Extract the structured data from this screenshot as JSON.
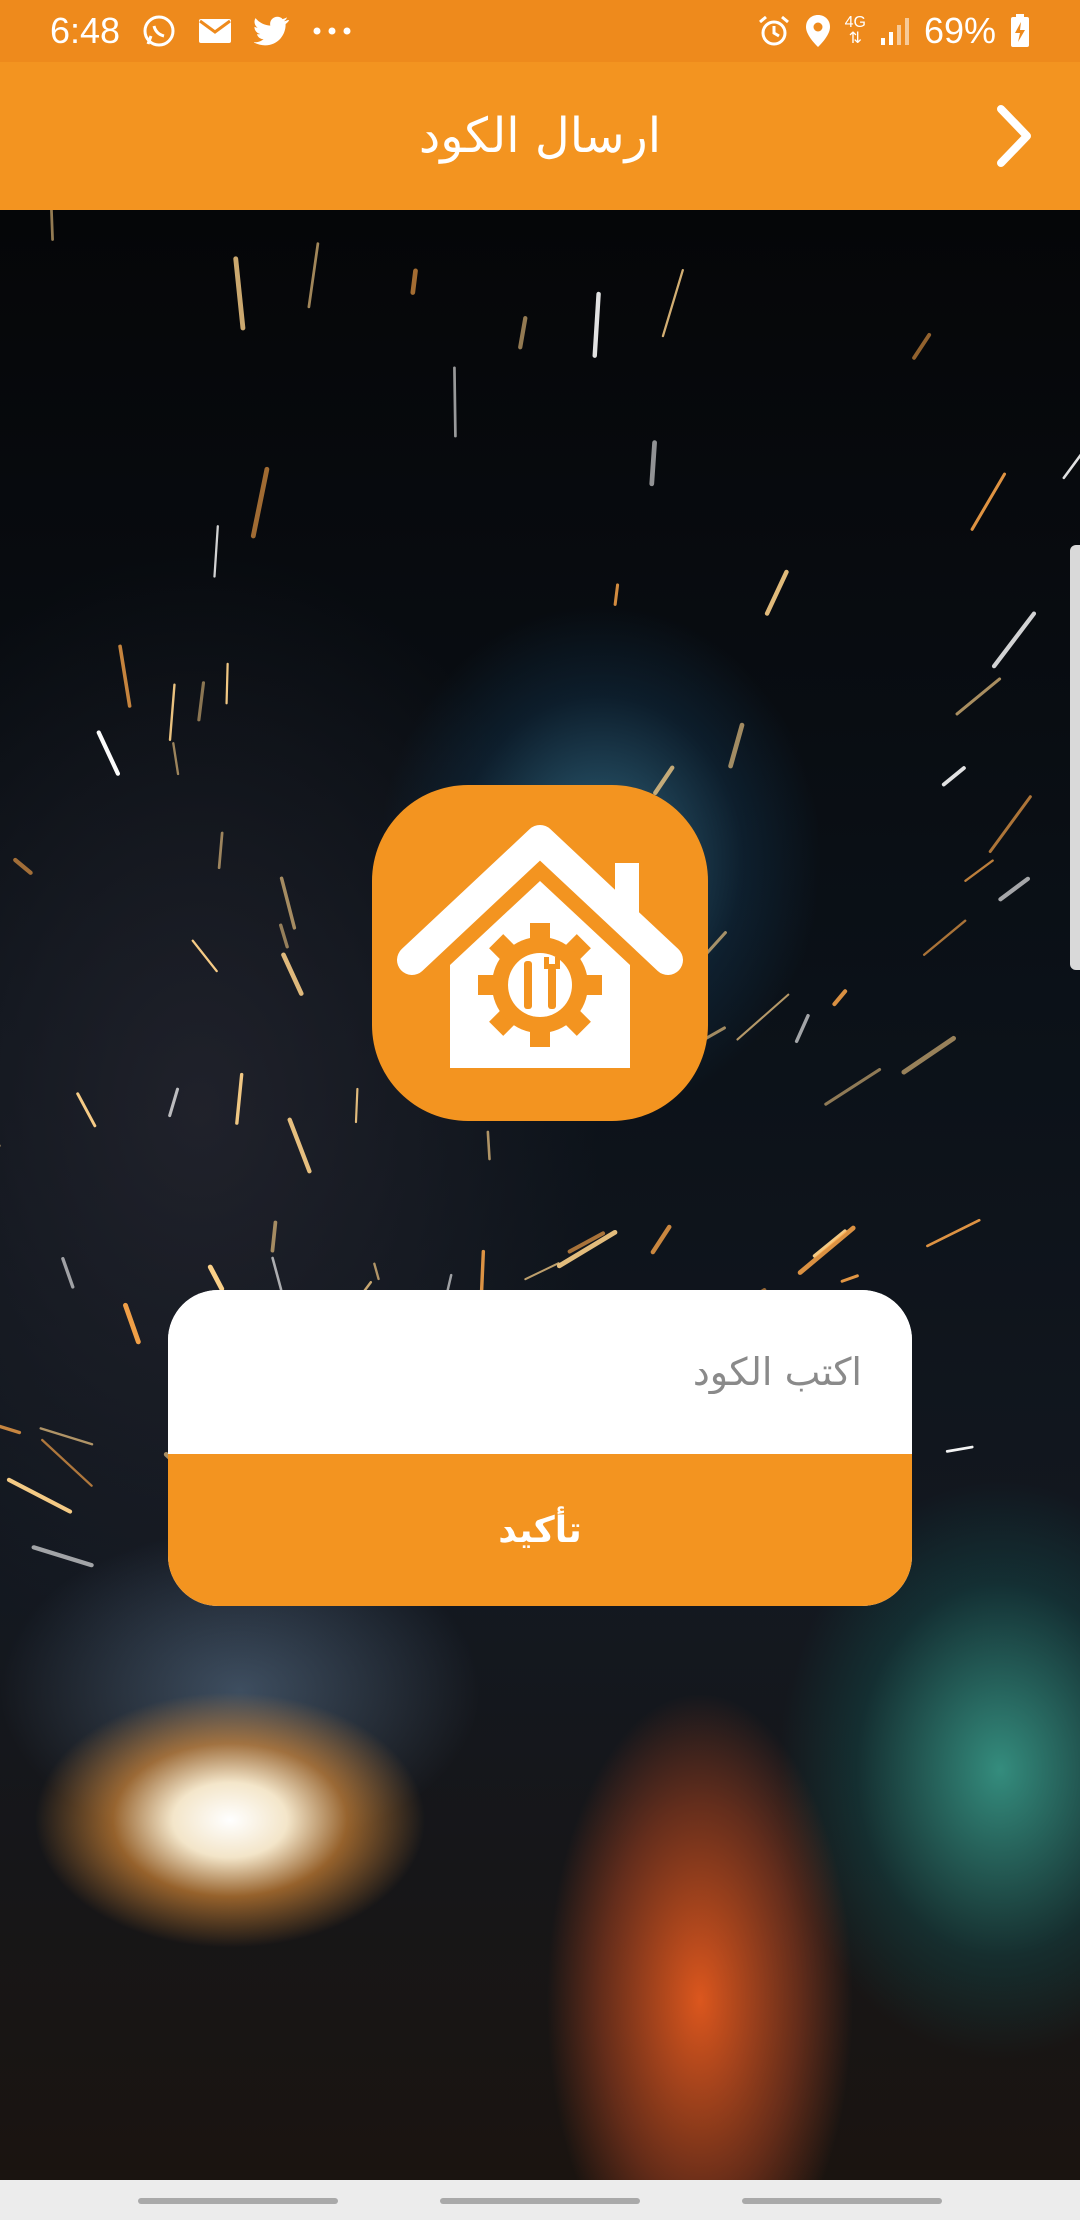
{
  "status_bar": {
    "time": "6:48",
    "network": "4G",
    "battery": "69%",
    "icons_left": [
      "whatsapp-icon",
      "mail-icon",
      "twitter-icon",
      "more-dots-icon"
    ],
    "icons_right": [
      "alarm-icon",
      "location-icon",
      "network-4g-icon",
      "signal-icon",
      "battery-charging-icon"
    ]
  },
  "app_bar": {
    "title": "ارسال الكود",
    "back_icon": "chevron-right-icon"
  },
  "logo": {
    "icon": "home-repair-gear-icon"
  },
  "form": {
    "code_placeholder": "اكتب الكود",
    "confirm_label": "تأكيد"
  },
  "colors": {
    "accent": "#f39420",
    "status_bar": "#ee8a1c",
    "text_light": "#ffffff"
  }
}
